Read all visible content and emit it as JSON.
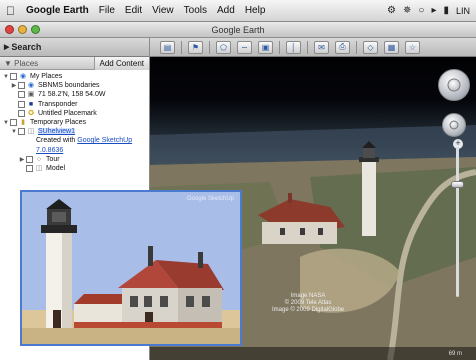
{
  "menubar": {
    "app_name": "Google Earth",
    "items": [
      "File",
      "Edit",
      "View",
      "Tools",
      "Add",
      "Help"
    ],
    "tray_text": "LIN"
  },
  "window": {
    "title": "Google Earth"
  },
  "toolbar": {
    "search_label": "Search"
  },
  "sidebar": {
    "places_label": "Places",
    "add_content_label": "Add Content",
    "tree": [
      {
        "label": "My Places",
        "icon": "folder-icon"
      },
      {
        "label": "SBNMS boundaries",
        "icon": "globe-icon"
      },
      {
        "label": "71 58.2'N, 158 54.0W",
        "icon": "placemark-icon"
      },
      {
        "label": "Transponder",
        "icon": "square-icon"
      },
      {
        "label": "Untitled Placemark",
        "icon": "pin-icon"
      },
      {
        "label": "Temporary Places",
        "icon": "folder-icon"
      },
      {
        "label": "SUhelview1",
        "icon": "model-icon"
      },
      {
        "label": "Created with",
        "link": "Google SketchUp",
        "icon": ""
      },
      {
        "label": "",
        "link": "7.0.8636",
        "icon": ""
      },
      {
        "label": "Tour",
        "icon": "tour-icon"
      },
      {
        "label": "Model",
        "icon": "model-icon"
      }
    ]
  },
  "view": {
    "attribution_line1": "Image NASA",
    "attribution_line2": "© 2009 Tele Atlas",
    "attribution_line3": "Image © 2009 DigitalGlobe",
    "status_alt": "69 m"
  },
  "popup": {
    "watermark": "Google SketchUp"
  },
  "colors": {
    "accent": "#4a7bd1",
    "link": "#1a4cc2"
  }
}
